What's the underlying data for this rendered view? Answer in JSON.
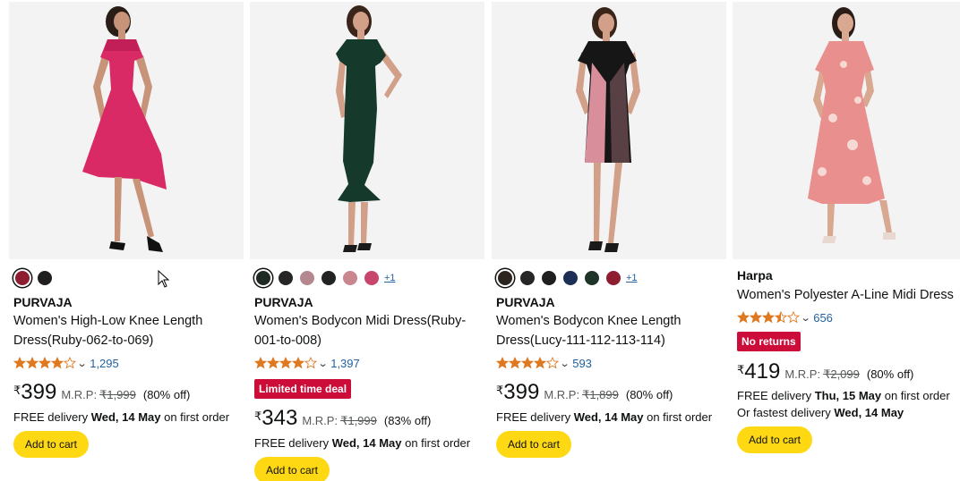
{
  "products": [
    {
      "brand": "PURVAJA",
      "title": "Women's High-Low Knee Length Dress(Ruby-062-to-069)",
      "swatch_colors": [
        "#8e1d32",
        "#1f1f1f"
      ],
      "swatch_more": "",
      "rating": 4.0,
      "rating_count": "1,295",
      "badge": "",
      "currency": "₹",
      "price": "399",
      "mrp_label": "M.R.P:",
      "mrp": "₹1,999",
      "discount": "(80% off)",
      "delivery_prefix": "FREE delivery ",
      "delivery_date": "Wed, 14 May",
      "delivery_suffix": " on first order",
      "fastest_prefix": "",
      "fastest_date": "",
      "cart_label": "Add to cart",
      "dress_color": "#d92a66"
    },
    {
      "brand": "PURVAJA",
      "title": "Women's Bodycon Midi Dress(Ruby-001-to-008)",
      "swatch_colors": [
        "#1f2a24",
        "#262626",
        "#b5888f",
        "#232323",
        "#c9868f",
        "#c8456c"
      ],
      "swatch_more": "+1",
      "rating": 4.0,
      "rating_count": "1,397",
      "badge": "Limited time deal",
      "currency": "₹",
      "price": "343",
      "mrp_label": "M.R.P:",
      "mrp": "₹1,999",
      "discount": "(83% off)",
      "delivery_prefix": "FREE delivery ",
      "delivery_date": "Wed, 14 May",
      "delivery_suffix": " on first order",
      "fastest_prefix": "",
      "fastest_date": "",
      "cart_label": "Add to cart",
      "dress_color": "#153a2c"
    },
    {
      "brand": "PURVAJA",
      "title": "Women's Bodycon Knee Length Dress(Lucy-111-112-113-114)",
      "swatch_colors": [
        "#2b241f",
        "#262626",
        "#1f1f1f",
        "#1e2f55",
        "#1f3428",
        "#8e1d32"
      ],
      "swatch_more": "+1",
      "rating": 4.0,
      "rating_count": "593",
      "badge": "",
      "currency": "₹",
      "price": "399",
      "mrp_label": "M.R.P:",
      "mrp": "₹1,899",
      "discount": "(80% off)",
      "delivery_prefix": "FREE delivery ",
      "delivery_date": "Wed, 14 May",
      "delivery_suffix": " on first order",
      "fastest_prefix": "",
      "fastest_date": "",
      "cart_label": "Add to cart",
      "dress_color": "#161616"
    },
    {
      "brand": "Harpa",
      "title": "Women's Polyester A-Line Midi Dress",
      "swatch_colors": [],
      "swatch_more": "",
      "rating": 3.5,
      "rating_count": "656",
      "badge": "No returns",
      "currency": "₹",
      "price": "419",
      "mrp_label": "M.R.P:",
      "mrp": "₹2,099",
      "discount": "(80% off)",
      "delivery_prefix": "FREE delivery ",
      "delivery_date": "Thu, 15 May",
      "delivery_suffix": " on first order",
      "fastest_prefix": "Or fastest delivery ",
      "fastest_date": "Wed, 14 May",
      "cart_label": "Add to cart",
      "dress_color": "#e9908f"
    }
  ],
  "colors": {
    "star": "#de7921",
    "link": "#2162a1",
    "deal_red": "#cc0c39",
    "cart_yellow": "#ffd814"
  }
}
